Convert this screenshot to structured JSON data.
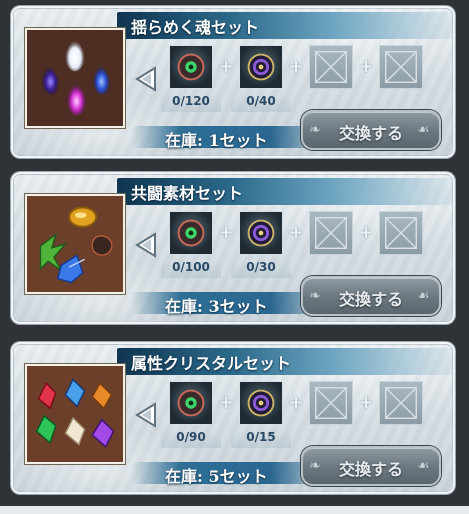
{
  "cards": [
    {
      "title": "揺らめく魂セット",
      "art": "soul-flames",
      "materials": [
        {
          "icon": "green-eye-orb",
          "count": "0/120"
        },
        {
          "icon": "purple-ring-orb",
          "count": "0/40"
        },
        {
          "icon": "empty-slot",
          "count": ""
        },
        {
          "icon": "empty-slot",
          "count": ""
        }
      ],
      "stock": "在庫: 1セット",
      "button_label": "交換する"
    },
    {
      "title": "共闘素材セット",
      "art": "coop-materials",
      "materials": [
        {
          "icon": "green-eye-orb",
          "count": "0/100"
        },
        {
          "icon": "purple-ring-orb",
          "count": "0/30"
        },
        {
          "icon": "empty-slot",
          "count": ""
        },
        {
          "icon": "empty-slot",
          "count": ""
        }
      ],
      "stock": "在庫: 3セット",
      "button_label": "交換する"
    },
    {
      "title": "属性クリスタルセット",
      "art": "element-crystals",
      "materials": [
        {
          "icon": "green-eye-orb",
          "count": "0/90"
        },
        {
          "icon": "purple-ring-orb",
          "count": "0/15"
        },
        {
          "icon": "empty-slot",
          "count": ""
        },
        {
          "icon": "empty-slot",
          "count": ""
        }
      ],
      "stock": "在庫: 5セット",
      "button_label": "交換する"
    }
  ],
  "colors": {
    "title_bar": "#1d4a66",
    "stock_bar": "#2e6f96",
    "button": "#6d7981"
  }
}
